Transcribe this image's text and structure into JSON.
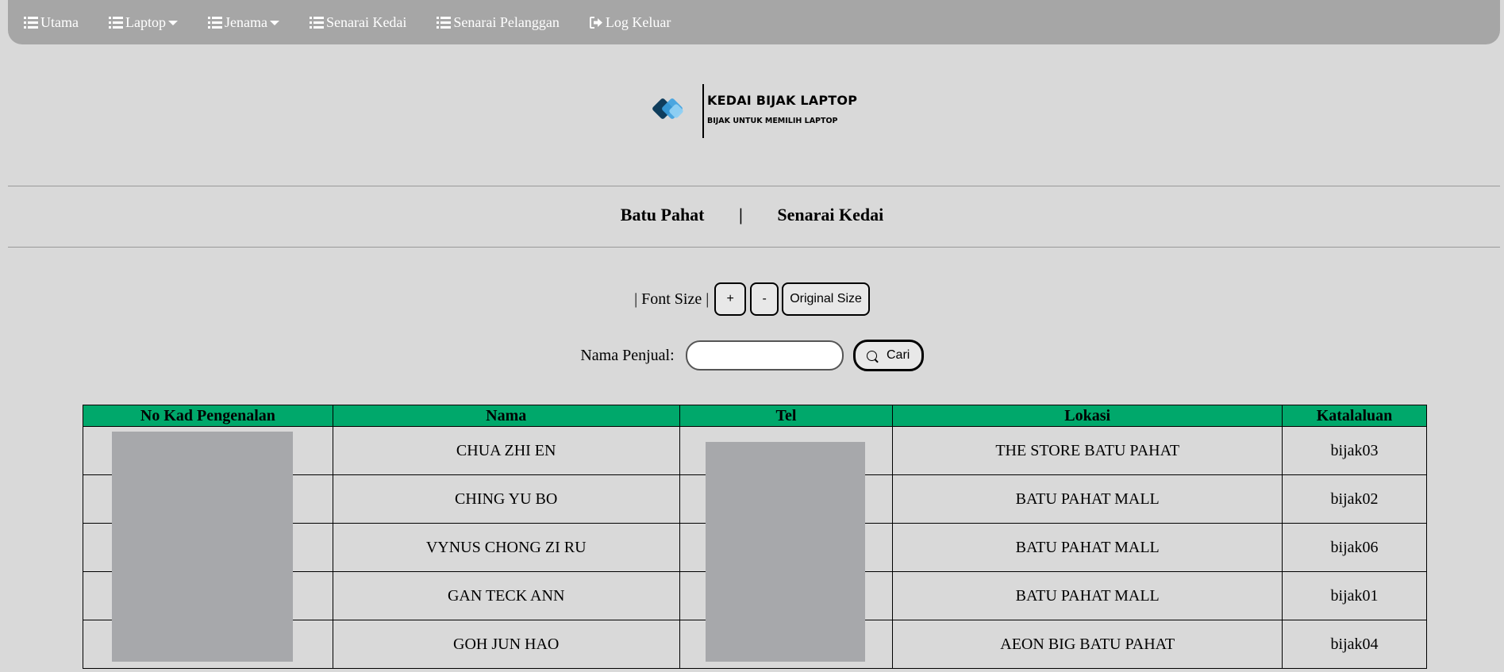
{
  "nav": {
    "items": [
      {
        "label": "Utama",
        "icon": "list-icon",
        "dropdown": false
      },
      {
        "label": "Laptop",
        "icon": "list-icon",
        "dropdown": true
      },
      {
        "label": "Jenama",
        "icon": "list-icon",
        "dropdown": true
      },
      {
        "label": "Senarai Kedai",
        "icon": "list-icon",
        "dropdown": false
      },
      {
        "label": "Senarai Pelanggan",
        "icon": "list-icon",
        "dropdown": false
      },
      {
        "label": "Log Keluar",
        "icon": "logout-icon",
        "dropdown": false
      }
    ]
  },
  "logo": {
    "title": "KEDAI BIJAK LAPTOP",
    "subtitle": "BIJAK UNTUK MEMILIH LAPTOP"
  },
  "subnav": {
    "location": "Batu Pahat",
    "separator": "|",
    "page": "Senarai Kedai"
  },
  "font_controls": {
    "label": "| Font Size |",
    "increase": "+",
    "decrease": "-",
    "reset": "Original Size"
  },
  "search": {
    "label": "Nama Penjual:",
    "value": "",
    "button": "Cari"
  },
  "table": {
    "headers": [
      "No Kad Pengenalan",
      "Nama",
      "Tel",
      "Lokasi",
      "Katalaluan"
    ],
    "rows": [
      {
        "nama": "CHUA ZHI EN",
        "lokasi": "THE STORE BATU PAHAT",
        "katalaluan": "bijak03"
      },
      {
        "nama": "CHING YU BO",
        "lokasi": "BATU PAHAT MALL",
        "katalaluan": "bijak02"
      },
      {
        "nama": "VYNUS CHONG ZI RU",
        "lokasi": "BATU PAHAT MALL",
        "katalaluan": "bijak06"
      },
      {
        "nama": "GAN TECK ANN",
        "lokasi": "BATU PAHAT MALL",
        "katalaluan": "bijak01"
      },
      {
        "nama": "GOH JUN HAO",
        "lokasi": "AEON BIG BATU PAHAT",
        "katalaluan": "bijak04"
      }
    ]
  },
  "colors": {
    "navbar": "#a6a6a6",
    "background": "#d9d9d9",
    "table_header": "#00a86b",
    "redaction": "#a7a8ab"
  }
}
